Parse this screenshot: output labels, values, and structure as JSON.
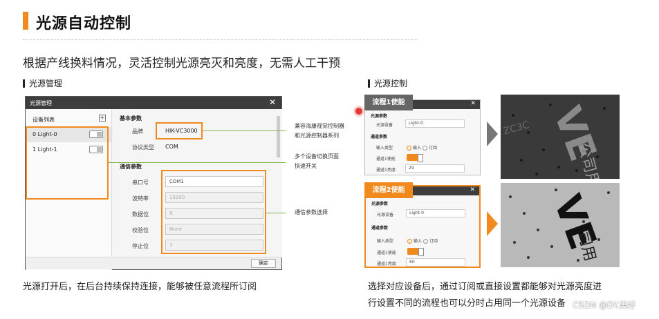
{
  "slide": {
    "title": "光源自动控制",
    "subtitle": "根据产线换料情况，灵活控制光源亮灭和亮度，无需人工干预",
    "left_section_label": "光源管理",
    "right_section_label": "光源控制",
    "left_caption": "光源打开后，在后台持续保持连接，能够被任意流程所订阅",
    "right_caption_line1": "选择对应设备后，通过订阅或直接设置都能够对光源亮度进",
    "right_caption_line2": "行设置不同的流程也可以分时占用同一个光源设备",
    "watermark": "CSDN @DY.美好"
  },
  "dialog": {
    "title": "光源管理",
    "close": "✕",
    "device_list_header": "设备列表",
    "add": "+",
    "devices": [
      {
        "label": "0  Light-0"
      },
      {
        "label": "1  Light-1"
      }
    ],
    "basic_params_header": "基本参数",
    "brand_label": "品牌",
    "brand_value": "HIK-VC3000",
    "protocol_label": "协议类型",
    "protocol_value": "COM",
    "comm_params_header": "通信参数",
    "serial_label": "串口号",
    "serial_value": "COM1",
    "baud_label": "波特率",
    "baud_value": "19200",
    "databits_label": "数据位",
    "databits_value": "8",
    "parity_label": "校验位",
    "parity_value": "None",
    "stopbits_label": "停止位",
    "stopbits_value": "1",
    "ok": "确定"
  },
  "notes": {
    "compat_line1": "兼容海康视觉控制器",
    "compat_line2": "和光源控制器系列",
    "multi_line1": "多个设备切换页面",
    "multi_line2": "快速开关",
    "comm": "通信参数选择"
  },
  "flows": [
    {
      "tag": "流程1使能",
      "tag_color": "#666666",
      "group1": "光源参数",
      "device_label": "光源设备",
      "device_value": "Light-0",
      "group2": "通道参数",
      "input_label": "输入类型",
      "opt_input": "输入",
      "opt_sub": "订阅",
      "enable_label": "通道1使能",
      "brightness_label": "通道1亮度",
      "brightness_value": "29"
    },
    {
      "tag": "流程2使能",
      "tag_color": "#f08a1e",
      "group1": "光源参数",
      "device_label": "光源设备",
      "device_value": "Light-0",
      "group2": "通道参数",
      "input_label": "输入类型",
      "opt_input": "输入",
      "opt_sub": "订阅",
      "enable_label": "通道1使能",
      "brightness_label": "通道1亮度",
      "brightness_value": "60"
    }
  ],
  "colors": {
    "accent": "#f08a1e",
    "line": "#7cb342",
    "dark": "#3d3d3d"
  }
}
